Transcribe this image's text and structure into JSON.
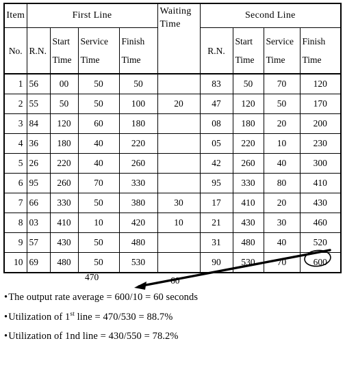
{
  "table": {
    "group_headers": {
      "item": "Item",
      "first_line": "First Line",
      "waiting_time_l1": "Waiting",
      "waiting_time_l2": "Time",
      "second_line": "Second Line"
    },
    "sub_headers": {
      "item_no": "No.",
      "rn1": "R.N.",
      "start1_l1": "Start",
      "start1_l2": "Time",
      "service1_l1": "Service",
      "service1_l2": "Time",
      "finish1_l1": "Finish",
      "finish1_l2": "Time",
      "rn2": "R.N.",
      "start2_l1": "Start",
      "start2_l2": "Time",
      "service2_l1": "Service",
      "service2_l2": "Time",
      "finish2_l1": "Finish",
      "finish2_l2": "Time"
    },
    "rows": [
      {
        "no": "1",
        "rn1": "56",
        "start1": "00",
        "service1": "50",
        "finish1": "50",
        "wait": "",
        "rn2": "83",
        "start2": "50",
        "service2": "70",
        "finish2": "120"
      },
      {
        "no": "2",
        "rn1": "55",
        "start1": "50",
        "service1": "50",
        "finish1": "100",
        "wait": "20",
        "rn2": "47",
        "start2": "120",
        "service2": "50",
        "finish2": "170"
      },
      {
        "no": "3",
        "rn1": "84",
        "start1": "120",
        "service1": "60",
        "finish1": "180",
        "wait": "",
        "rn2": "08",
        "start2": "180",
        "service2": "20",
        "finish2": "200"
      },
      {
        "no": "4",
        "rn1": "36",
        "start1": "180",
        "service1": "40",
        "finish1": "220",
        "wait": "",
        "rn2": "05",
        "start2": "220",
        "service2": "10",
        "finish2": "230"
      },
      {
        "no": "5",
        "rn1": "26",
        "start1": "220",
        "service1": "40",
        "finish1": "260",
        "wait": "",
        "rn2": "42",
        "start2": "260",
        "service2": "40",
        "finish2": "300"
      },
      {
        "no": "6",
        "rn1": "95",
        "start1": "260",
        "service1": "70",
        "finish1": "330",
        "wait": "",
        "rn2": "95",
        "start2": "330",
        "service2": "80",
        "finish2": "410"
      },
      {
        "no": "7",
        "rn1": "66",
        "start1": "330",
        "service1": "50",
        "finish1": "380",
        "wait": "30",
        "rn2": "17",
        "start2": "410",
        "service2": "20",
        "finish2": "430"
      },
      {
        "no": "8",
        "rn1": "03",
        "start1": "410",
        "service1": "10",
        "finish1": "420",
        "wait": "10",
        "rn2": "21",
        "start2": "430",
        "service2": "30",
        "finish2": "460"
      },
      {
        "no": "9",
        "rn1": "57",
        "start1": "430",
        "service1": "50",
        "finish1": "480",
        "wait": "",
        "rn2": "31",
        "start2": "480",
        "service2": "40",
        "finish2": "520"
      },
      {
        "no": "10",
        "rn1": "69",
        "start1": "480",
        "service1": "50",
        "finish1": "530",
        "wait": "",
        "rn2": "90",
        "start2": "530",
        "service2": "70",
        "finish2": "600"
      }
    ]
  },
  "totals": {
    "first_line_service_total": "470",
    "waiting_time_total": "60"
  },
  "annotation": {
    "circled_value": "600",
    "arrow_from": "circled 600 in Second Line Finish Time",
    "arrow_to": "60 waiting time total"
  },
  "notes": [
    {
      "bullet": "•",
      "pre": "The output rate average = 600/10 = 60 seconds",
      "sup": "",
      "post": ""
    },
    {
      "bullet": "•",
      "pre": "Utilization of  1",
      "sup": "st",
      "post": " line = 470/530 = 88.7%"
    },
    {
      "bullet": "•",
      "pre": "Utilization of  1nd line = 430/550 = 78.2%",
      "sup": "",
      "post": ""
    }
  ],
  "colors": {
    "ink": "#000000",
    "paper": "#ffffff"
  }
}
